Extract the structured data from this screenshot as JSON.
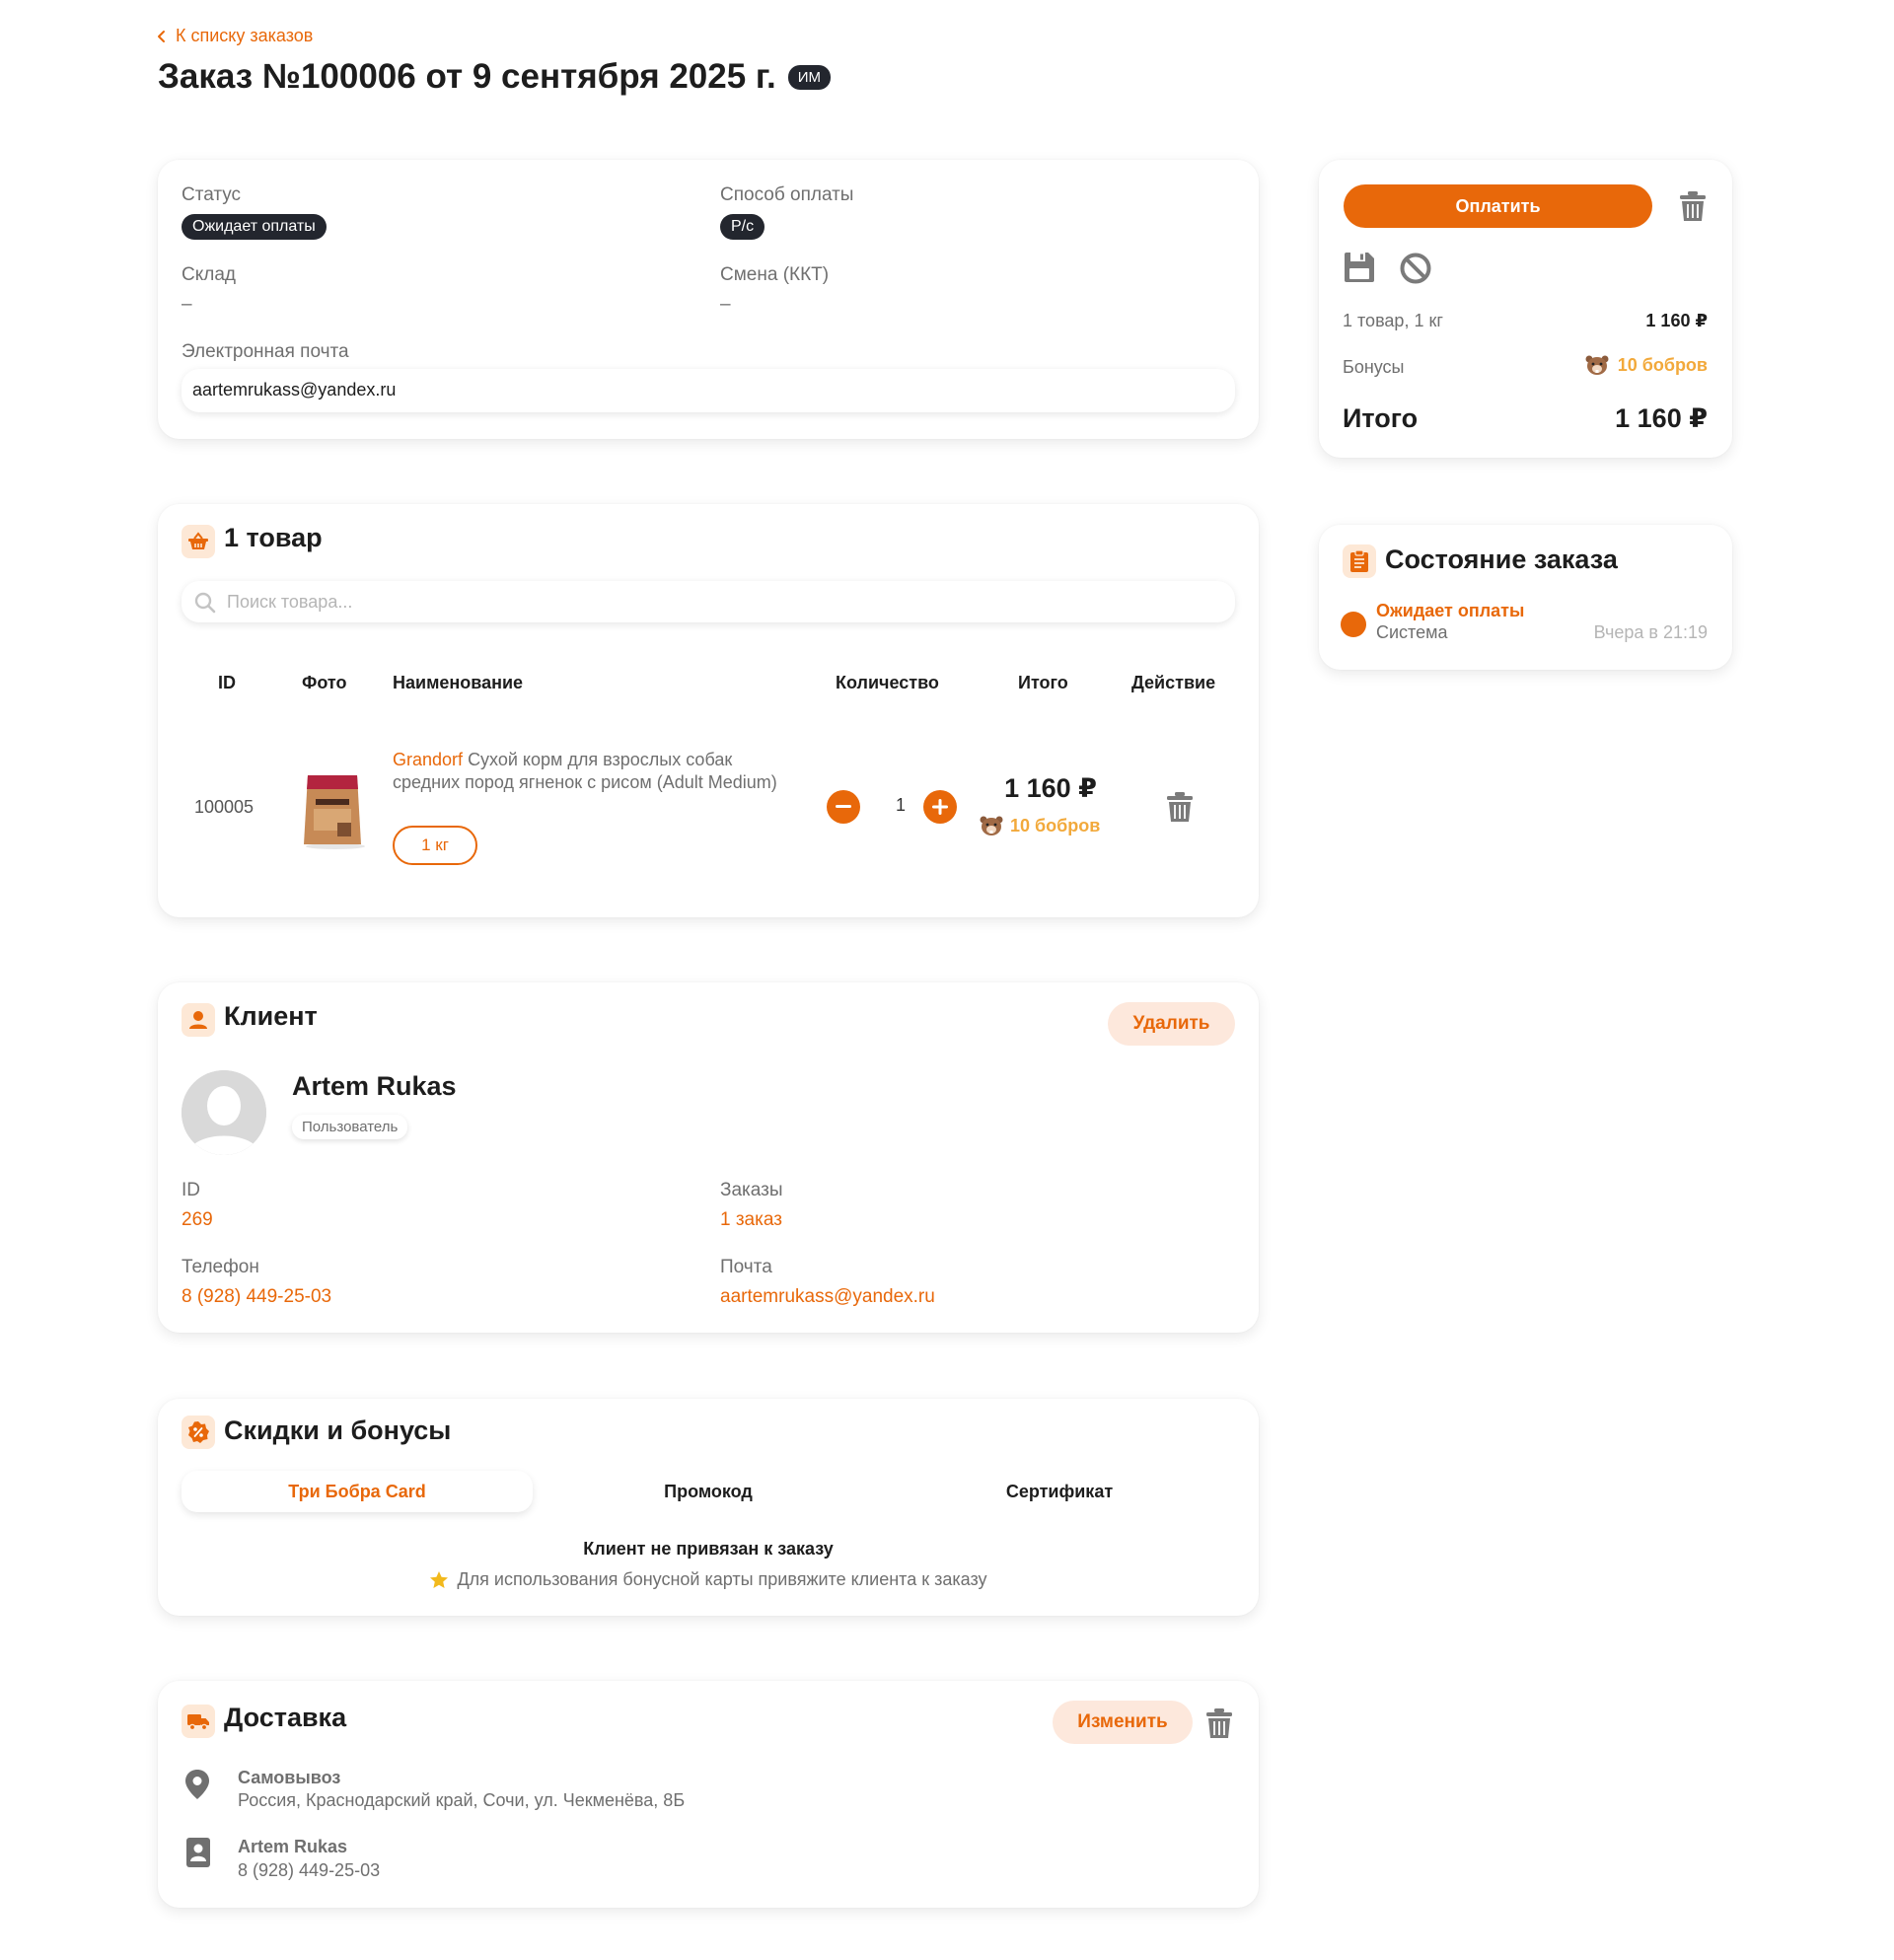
{
  "header": {
    "back_link": "К списку заказов",
    "title": "Заказ №100006 от 9 сентября 2025 г.",
    "badge": "ИМ"
  },
  "info": {
    "status_label": "Статус",
    "status_value": "Ожидает оплаты",
    "payment_label": "Способ оплаты",
    "payment_value": "Р/с",
    "warehouse_label": "Склад",
    "warehouse_value": "–",
    "shift_label": "Смена (ККТ)",
    "shift_value": "–",
    "email_label": "Электронная почта",
    "email_value": "aartemrukass@yandex.ru"
  },
  "products": {
    "title": "1 товар",
    "search_placeholder": "Поиск товара...",
    "columns": [
      "ID",
      "Фото",
      "Наименование",
      "Количество",
      "Итого",
      "Действие"
    ],
    "rows": [
      {
        "id": "100005",
        "brand": "Grandorf",
        "name": "Сухой корм для взрослых собак средних пород ягненок с рисом (Adult Medium)",
        "weight": "1 кг",
        "qty": "1",
        "total": "1 160 ₽",
        "bonus": "10 бобров"
      }
    ]
  },
  "client": {
    "title": "Клиент",
    "delete_label": "Удалить",
    "name": "Artem Rukas",
    "role": "Пользователь",
    "id_label": "ID",
    "id_value": "269",
    "orders_label": "Заказы",
    "orders_value": "1 заказ",
    "phone_label": "Телефон",
    "phone_value": "8 (928) 449-25-03",
    "email_label": "Почта",
    "email_value": "aartemrukass@yandex.ru"
  },
  "discounts": {
    "title": "Скидки и бонусы",
    "tabs": [
      "Три Бобра Card",
      "Промокод",
      "Сертификат"
    ],
    "active_tab": 0,
    "notice_title": "Клиент не привязан к заказу",
    "notice_text": "Для использования бонусной карты привяжите клиента к заказу"
  },
  "delivery": {
    "title": "Доставка",
    "edit_label": "Изменить",
    "method": "Самовывоз",
    "address": "Россия, Краснодарский край, Сочи, ул. Чекменёва, 8Б",
    "contact_name": "Artem Rukas",
    "contact_phone": "8 (928) 449-25-03"
  },
  "summary": {
    "pay_label": "Оплатить",
    "items_label": "1 товар, 1 кг",
    "items_value": "1 160 ₽",
    "bonus_label": "Бонусы",
    "bonus_value": "10 бобров",
    "total_label": "Итого",
    "total_value": "1 160 ₽"
  },
  "order_state": {
    "title": "Состояние заказа",
    "status": "Ожидает оплаты",
    "actor": "Система",
    "time": "Вчера в 21:19"
  },
  "colors": {
    "accent": "#e8680a",
    "accent_soft": "#fde8dc",
    "bonus": "#f2a93b",
    "dark_pill": "#23262e"
  },
  "icons": [
    "chevron-left-icon",
    "basket-icon",
    "search-icon",
    "trash-icon",
    "user-icon",
    "discount-icon",
    "truck-icon",
    "map-pin-icon",
    "contact-card-icon",
    "save-icon",
    "cancel-icon",
    "clipboard-icon",
    "beaver-icon",
    "star-icon"
  ]
}
